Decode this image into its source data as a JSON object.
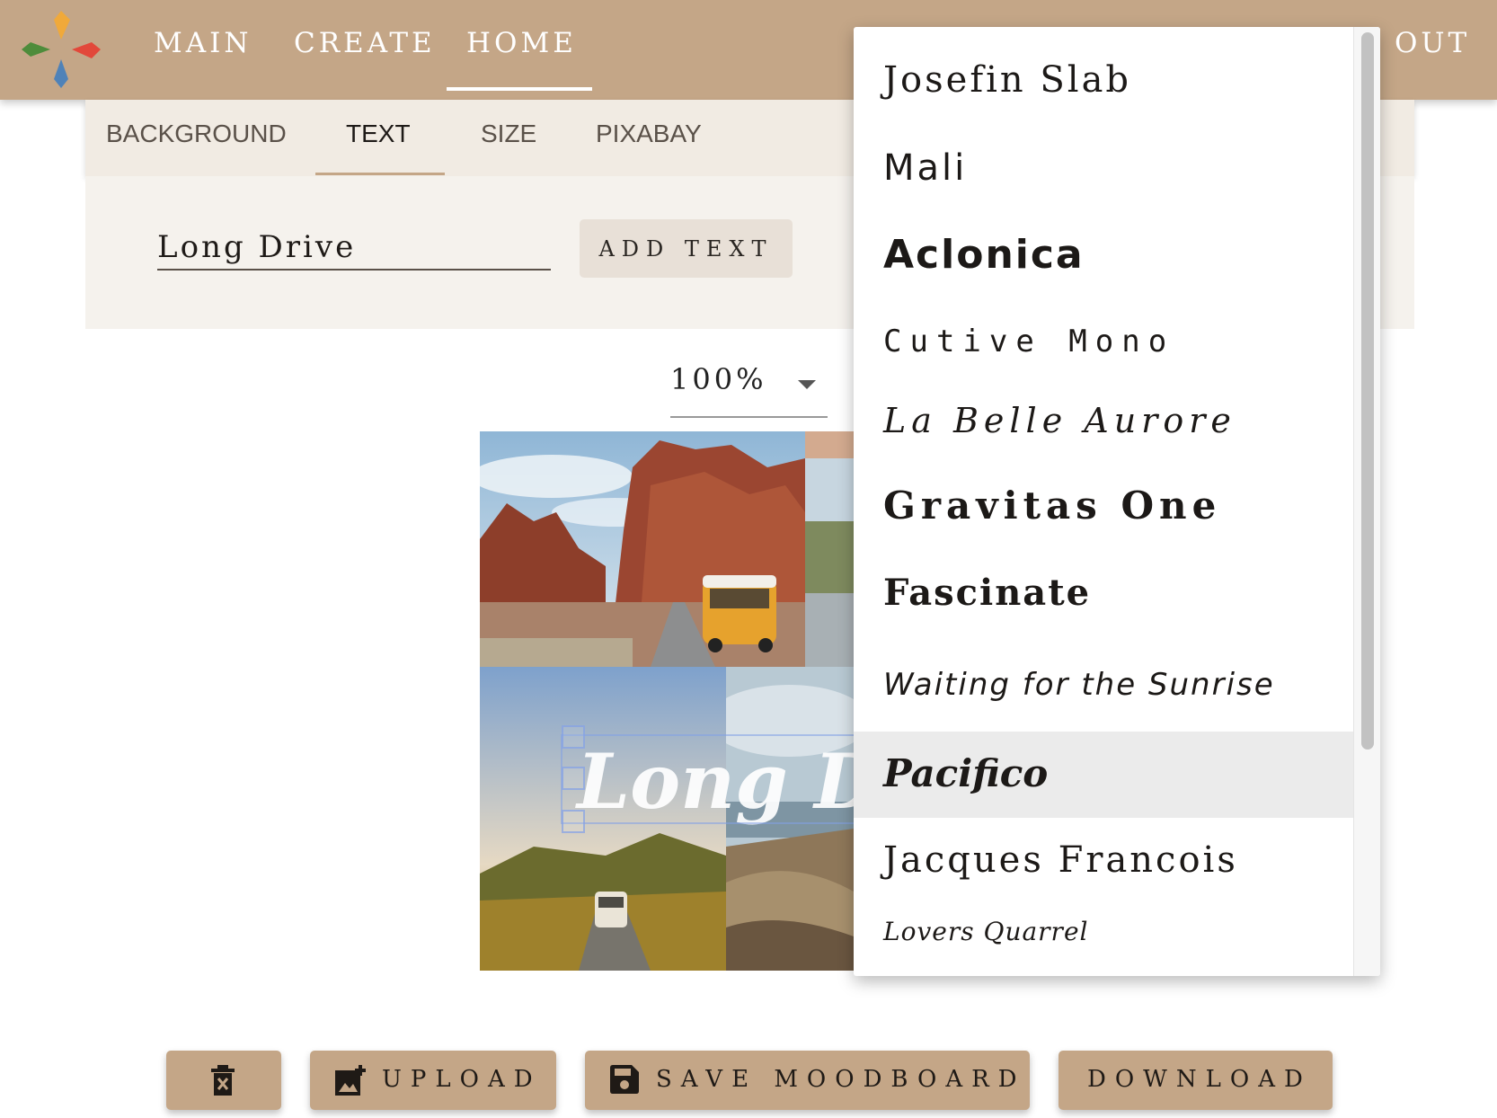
{
  "nav": {
    "items": [
      {
        "label": "MAIN"
      },
      {
        "label": "CREATE"
      },
      {
        "label": "HOME"
      }
    ],
    "logout_label": "OUT"
  },
  "tabs": [
    {
      "label": "BACKGROUND"
    },
    {
      "label": "TEXT"
    },
    {
      "label": "SIZE"
    },
    {
      "label": "PIXABAY"
    }
  ],
  "active_tab": "TEXT",
  "text_panel": {
    "input_value": "Long Drive",
    "add_text_label": "ADD TEXT"
  },
  "zoom": {
    "value": "100%"
  },
  "canvas": {
    "overlay_text": "Long Dr"
  },
  "font_dropdown": {
    "options": [
      {
        "label": "Josefin Slab"
      },
      {
        "label": "Mali"
      },
      {
        "label": "Aclonica"
      },
      {
        "label": "Cutive Mono"
      },
      {
        "label": "La Belle Aurore"
      },
      {
        "label": "Gravitas One"
      },
      {
        "label": "Fascinate"
      },
      {
        "label": "Waiting for the Sunrise"
      },
      {
        "label": "Pacifico"
      },
      {
        "label": "Jacques Francois"
      },
      {
        "label": "Lovers Quarrel"
      }
    ],
    "highlighted": "Pacifico"
  },
  "actions": {
    "upload_label": "UPLOAD",
    "save_label": "SAVE MOODBOARD",
    "download_label": "DOWNLOAD"
  },
  "colors": {
    "brand": "#c4a687",
    "panel": "#f1ebe3",
    "highlight": "#ebebeb"
  }
}
